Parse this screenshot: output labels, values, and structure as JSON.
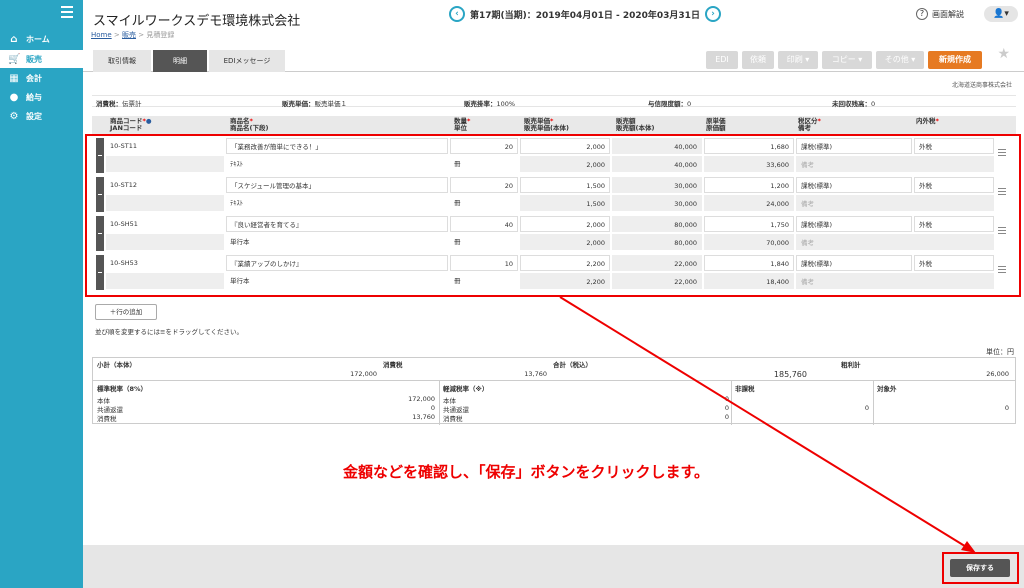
{
  "sidebar": {
    "items": [
      {
        "icon": "home-icon",
        "label": "ホーム"
      },
      {
        "icon": "cart-icon",
        "label": "販売"
      },
      {
        "icon": "calculator-icon",
        "label": "会計"
      },
      {
        "icon": "moneybag-icon",
        "label": "給与"
      },
      {
        "icon": "gear-icon",
        "label": "設定"
      }
    ]
  },
  "header": {
    "company": "スマイルワークスデモ環境株式会社",
    "period": "第17期(当期)：2019年04月01日 - 2020年03月31日",
    "help": "画面解説"
  },
  "breadcrumb": {
    "home": "Home",
    "sep1": ">",
    "sales": "販売",
    "sep2": ">",
    "current": "見積登録"
  },
  "tabs": [
    "取引情報",
    "明細",
    "EDIメッセージ"
  ],
  "actions": {
    "edi": "EDI",
    "approve": "依頼",
    "print": "印刷 ▾",
    "copy": "コピー ▾",
    "other": "その他 ▾",
    "new": "新規作成"
  },
  "partner": "北海道送商事株式会社",
  "info": {
    "tax_label": "消費税：",
    "tax_value": "伝票計",
    "price_label": "販売単価：",
    "price_value": "販売単価１",
    "rate_label": "販売掛率：",
    "rate_value": "100%",
    "credit_label": "与信限度額：",
    "credit_value": "0",
    "unreceived_label": "未回収残高：",
    "unreceived_value": "0"
  },
  "columns": {
    "code1": "商品コード",
    "code2": "JANコード",
    "name1": "商品名",
    "name2": "商品名(下段)",
    "qty1": "数量",
    "qty2": "単位",
    "price1": "販売単価",
    "price2": "販売単価(本体)",
    "amount1": "販売額",
    "amount2": "販売額(本体)",
    "cost1": "原単価",
    "cost2": "原価額",
    "taxcls1": "税区分",
    "taxcls2": "備考",
    "inout": "内外税"
  },
  "rows": [
    {
      "code": "10-ST11",
      "name": "「業務改善が簡単にできる！」",
      "qty": "20",
      "price": "2,000",
      "amount": "40,000",
      "cost": "1,680",
      "taxcls": "課税(標準)",
      "inout": "外税",
      "name2": "ﾃｷｽﾄ",
      "unit": "冊",
      "price2": "2,000",
      "amount2": "40,000",
      "cost2": "33,600",
      "note": "備考"
    },
    {
      "code": "10-ST12",
      "name": "「スケジュール管理の基本」",
      "qty": "20",
      "price": "1,500",
      "amount": "30,000",
      "cost": "1,200",
      "taxcls": "課税(標準)",
      "inout": "外税",
      "name2": "ﾃｷｽﾄ",
      "unit": "冊",
      "price2": "1,500",
      "amount2": "30,000",
      "cost2": "24,000",
      "note": "備考"
    },
    {
      "code": "10-SH51",
      "name": "『良い経営者を育てる』",
      "qty": "40",
      "price": "2,000",
      "amount": "80,000",
      "cost": "1,750",
      "taxcls": "課税(標準)",
      "inout": "外税",
      "name2": "単行本",
      "unit": "冊",
      "price2": "2,000",
      "amount2": "80,000",
      "cost2": "70,000",
      "note": "備考"
    },
    {
      "code": "10-SH53",
      "name": "『業績アップのしかけ』",
      "qty": "10",
      "price": "2,200",
      "amount": "22,000",
      "cost": "1,840",
      "taxcls": "課税(標準)",
      "inout": "外税",
      "name2": "単行本",
      "unit": "冊",
      "price2": "2,200",
      "amount2": "22,000",
      "cost2": "18,400",
      "note": "備考"
    }
  ],
  "add_row": "＋行の追加",
  "drag_hint": "並び順を変更するには≡をドラッグしてください。",
  "unit_label": "単位：円",
  "summary": {
    "subtotal_label": "小計（本体）",
    "subtotal": "172,000",
    "tax_label": "消費税",
    "tax": "13,760",
    "total_label": "合計（税込）",
    "total": "185,760",
    "profit_label": "粗利計",
    "profit": "26,000"
  },
  "tax_breakdown": {
    "standard_label": "標準税率（8%）",
    "reduced_label": "軽減税率（※）",
    "nontax_label": "非課税",
    "exempt_label": "対象外",
    "body_label": "本体",
    "common_label": "共通返還",
    "tax_label": "消費税",
    "std_body": "172,000",
    "std_common": "0",
    "std_tax": "13,760",
    "red_body": "0",
    "red_common": "0",
    "red_tax": "0",
    "nontax": "0",
    "exempt": "0"
  },
  "save": "保存する",
  "annotation": "金額などを確認し、「保存」ボタンをクリックします。",
  "colors": {
    "sidebar": "#2aa5c4",
    "accent": "#e67a22",
    "highlight": "#e00000"
  }
}
